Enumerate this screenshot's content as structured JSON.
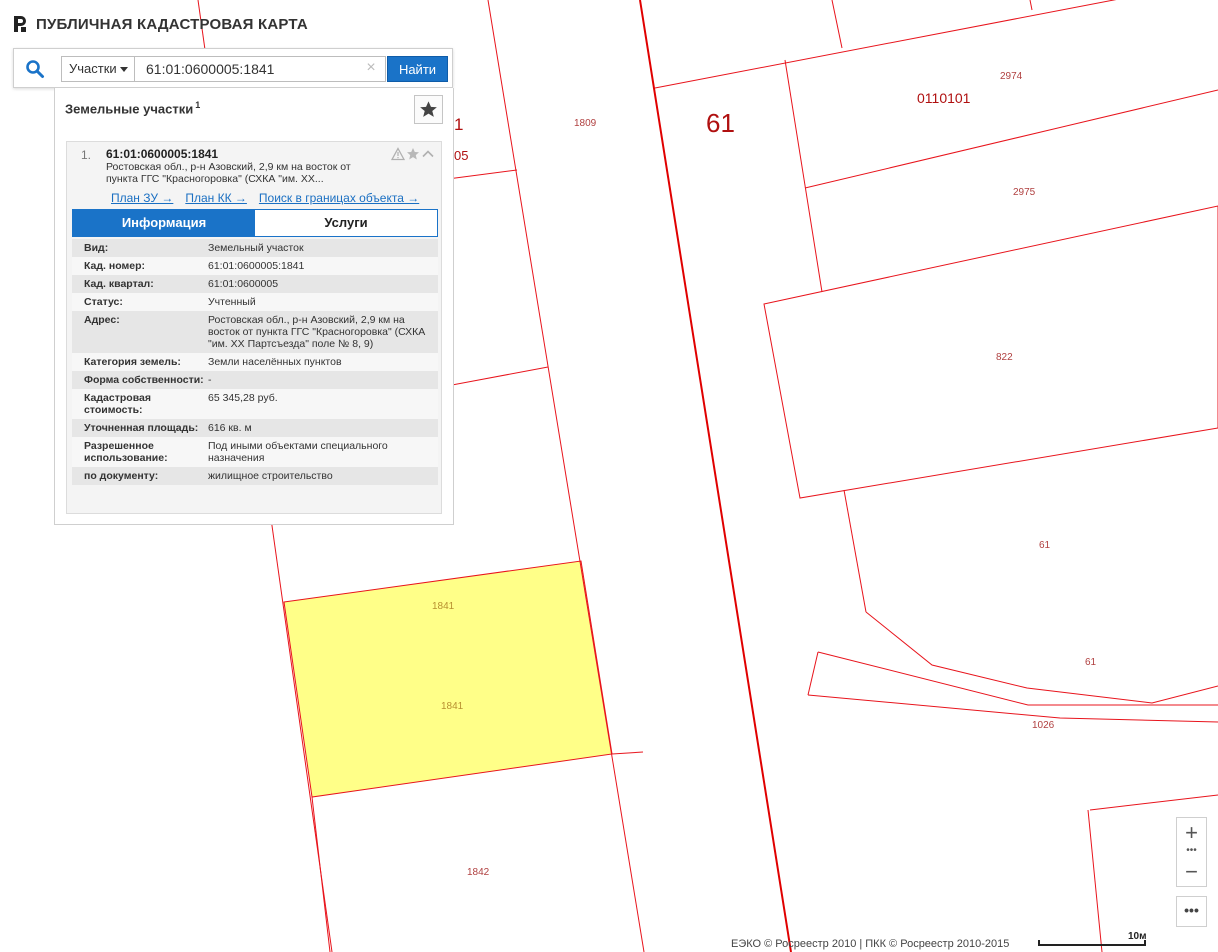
{
  "header": {
    "title": "ПУБЛИЧНАЯ КАДАСТРОВАЯ КАРТА"
  },
  "search": {
    "type_label": "Участки",
    "query": "61:01:0600005:1841",
    "find_label": "Найти",
    "clear_glyph": "×"
  },
  "results": {
    "title": "Земельные участки",
    "count": "1",
    "item": {
      "index": "1.",
      "cad_number": "61:01:0600005:1841",
      "address_short": "Ростовская обл., р-н Азовский, 2,9 км на восток от пункта ГГС \"Красногоровка\" (СХКА \"им. ХХ...",
      "links": [
        "План ЗУ →",
        "План КК →",
        "Поиск в границах объекта →"
      ]
    },
    "tabs": {
      "info": "Информация",
      "services": "Услуги"
    },
    "properties": [
      {
        "key": "Вид:",
        "value": "Земельный участок"
      },
      {
        "key": "Кад. номер:",
        "value": "61:01:0600005:1841"
      },
      {
        "key": "Кад. квартал:",
        "value": "61:01:0600005"
      },
      {
        "key": "Статус:",
        "value": "Учтенный"
      },
      {
        "key": "Адрес:",
        "value": "Ростовская обл., р-н Азовский, 2,9 км на восток от пункта ГГС \"Красногоровка\" (СХКА \"им. ХХ Партсъезда\" поле № 8, 9)"
      },
      {
        "key": "Категория земель:",
        "value": "Земли населённых пунктов"
      },
      {
        "key": "Форма собственности:",
        "value": "-"
      },
      {
        "key": "Кадастровая стоимость:",
        "value": "65 345,28 руб."
      },
      {
        "key": "Уточненная площадь:",
        "value": "616 кв. м"
      },
      {
        "key": "Разрешенное использование:",
        "value": "Под иными объектами специального назначения"
      },
      {
        "key": "по документу:",
        "value": "жилищное строительство"
      }
    ]
  },
  "map": {
    "labels": {
      "l1809": "1809",
      "l61_big": "61",
      "l0110101": "0110101",
      "l2974": "2974",
      "l2975": "2975",
      "l822": "822",
      "l61_a": "61",
      "l61_b": "61",
      "l1026": "1026",
      "l1841_top": "1841",
      "l1841_mid": "1841",
      "l1842": "1842",
      "partial_1": "1",
      "partial_05": "05"
    },
    "colors": {
      "boundary": "#e8141c",
      "selected_fill": "#ffff88",
      "road": "#e00000"
    }
  },
  "controls": {
    "zoom_in": "+",
    "zoom_dots": "•••",
    "zoom_out": "−",
    "more": "•••"
  },
  "footer": {
    "attribution": "ЕЭКО © Росреестр 2010 | ПКК © Росреестр 2010-2015",
    "scale": "10м"
  }
}
